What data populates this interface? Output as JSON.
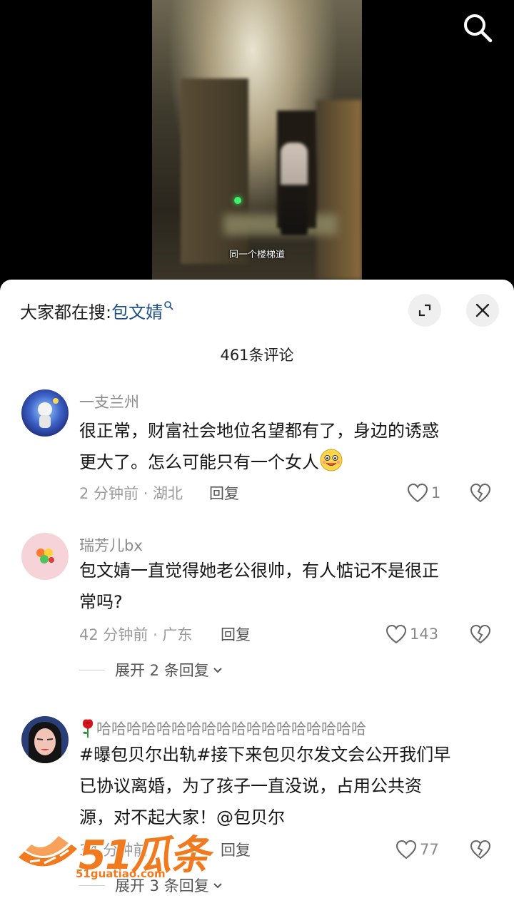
{
  "video": {
    "caption": "同一个楼梯道",
    "search_icon": "search-icon"
  },
  "panel": {
    "search_prefix": "大家都在搜:",
    "search_keyword": "包文婧",
    "expand_icon": "expand-icon",
    "close_icon": "close-icon",
    "comment_count": "461条评论"
  },
  "comments": [
    {
      "username": "一支兰州",
      "text_line1": "很正常，财富社会地位名望都有了，身边的诱惑",
      "text_line2": "更大了。怎么可能只有一个女人",
      "emoji": "smile-emoji",
      "meta": "2 分钟前 · 湖北",
      "reply": "回复",
      "likes": "1"
    },
    {
      "username": "瑞芳儿bx",
      "text_line1": "包文婧一直觉得她老公很帅，有人惦记不是很正",
      "text_line2": "常吗?",
      "meta": "42 分钟前 · 广东",
      "reply": "回复",
      "likes": "143",
      "expand": "展开 2 条回复"
    },
    {
      "username": "哈哈哈哈哈哈哈哈哈哈哈哈哈哈哈哈哈哈",
      "username_prefix_icon": "rose-icon",
      "text_line1": "#曝包贝尔出轨#接下来包贝尔发文会公开我们早",
      "text_line2": "已协议离婚，为了孩子一直没说，占用公共资",
      "text_line3": "源，对不起大家！@包贝尔",
      "meta": "34 分钟前",
      "reply": "回复",
      "likes": "77",
      "expand": "展开 3 条回复"
    }
  ],
  "watermark": {
    "brand": "51瓜条",
    "url": "51guatiao.com"
  },
  "colors": {
    "accent_keyword": "#1f4f86",
    "watermark": "#f17a1f"
  }
}
